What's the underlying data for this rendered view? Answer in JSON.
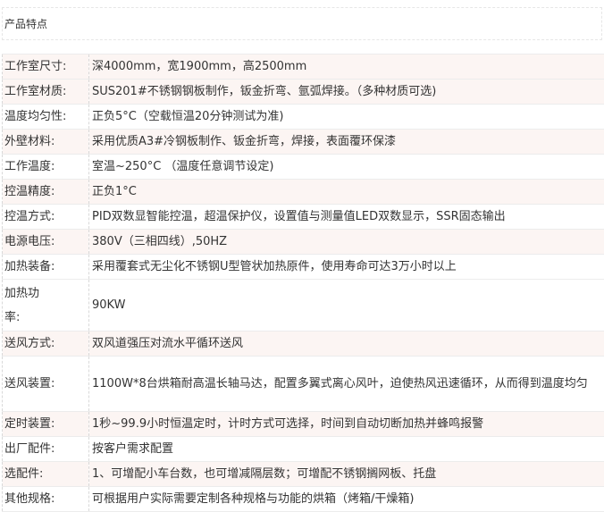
{
  "section": {
    "title": "产品特点"
  },
  "specs": [
    {
      "label": "工作室尺寸:",
      "value": "深4000mm，宽1900mm，高2500mm"
    },
    {
      "label": "工作室材质:",
      "value": "SUS201#不锈钢钢板制作，钣金折弯、氩弧焊接。（多种材质可选)"
    },
    {
      "label": "温度均匀性:",
      "value": " 正负5°C（空载恒温20分钟测试为准)"
    },
    {
      "label": "外壁材料:",
      "value": "采用优质A3#冷钢板制作、钣金折弯，焊接，表面覆环保漆"
    },
    {
      "label": "工作温度:",
      "value": "室温~250°C （温度任意调节设定)"
    },
    {
      "label": "控温精度:",
      "value": "正负1°C"
    },
    {
      "label": "控温方式:",
      "value": "PID双数显智能控温，超温保护仪，设置值与测量值LED双数显示，SSR固态输出"
    },
    {
      "label": "电源电压:",
      "value": "380V（三相四线）,50HZ"
    },
    {
      "label": "加热装备:",
      "value": "采用覆套式无尘化不锈钢U型管状加热原件，使用寿命可达3万小时以上"
    },
    {
      "label": "加热功率:",
      "value": "90KW"
    },
    {
      "label": "送风方式:",
      "value": "双风道强压对流水平循环送风"
    },
    {
      "label": "送风装置:",
      "value": "1100W*8台烘箱耐高温长轴马达，配置多翼式离心风叶，迫使热风迅速循环，从而得到温度均匀"
    },
    {
      "label": "定时装置:",
      "value": " 1秒~99.9小时恒温定时，计时方式可选择，时间到自动切断加热并蜂鸣报警"
    },
    {
      "label": "出厂配件:",
      "value": "按客户需求配置"
    },
    {
      "label": "选配件:",
      "value": "1、可增配小车台数，也可增减隔层数；可增配不锈钢搁网板、托盘"
    },
    {
      "label": "其他规格:",
      "value": "可根据用户实际需要定制各种规格与功能的烘箱（烤箱/干燥箱)"
    }
  ]
}
